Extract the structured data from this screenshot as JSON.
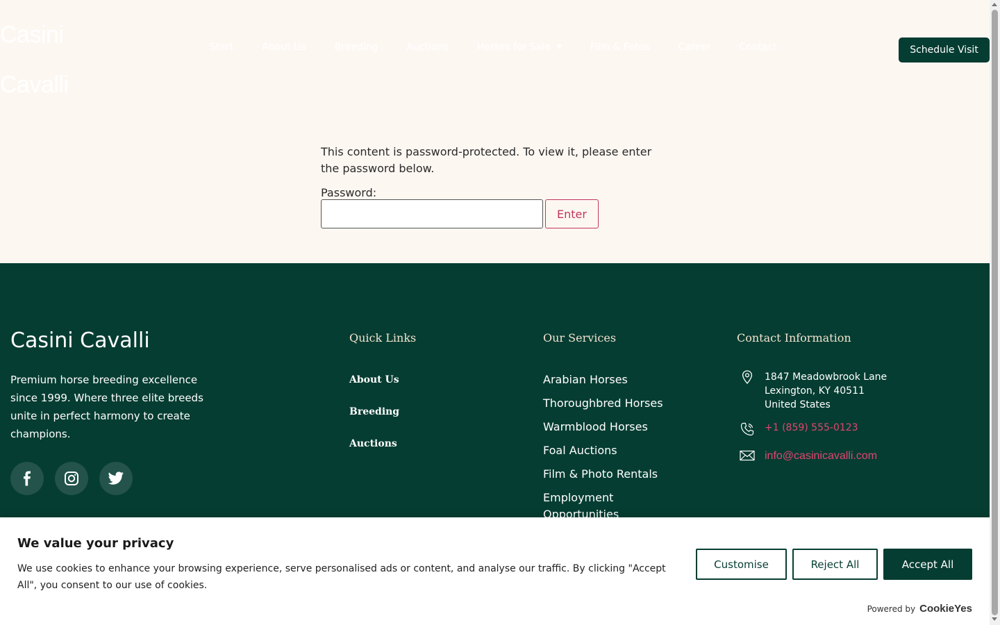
{
  "header": {
    "logo_line1": "Casini",
    "logo_line2": "Cavalli",
    "nav": [
      {
        "label": "Start"
      },
      {
        "label": "About Us"
      },
      {
        "label": "Breeding"
      },
      {
        "label": "Auctions"
      },
      {
        "label": "Horses for Sale"
      },
      {
        "label": "Film & Fotos"
      },
      {
        "label": "Career"
      },
      {
        "label": "Contact"
      }
    ],
    "schedule_label": "Schedule Visit"
  },
  "password": {
    "message": "This content is password-protected. To view it, please enter the password below.",
    "label": "Password:",
    "value": "",
    "enter_label": "Enter"
  },
  "footer": {
    "brand_name": "Casini Cavalli",
    "brand_desc": "Premium horse breeding excellence since 1999. Where three elite breeds unite in perfect harmony to create champions.",
    "socials": [
      {
        "icon": "facebook-icon"
      },
      {
        "icon": "instagram-icon"
      },
      {
        "icon": "twitter-icon"
      }
    ],
    "quick_links_title": "Quick Links",
    "quick_links": [
      {
        "label": "About Us"
      },
      {
        "label": "Breeding"
      },
      {
        "label": "Auctions"
      }
    ],
    "services_title": "Our Services",
    "services": [
      {
        "label": "Arabian Horses"
      },
      {
        "label": "Thoroughbred Horses"
      },
      {
        "label": "Warmblood Horses"
      },
      {
        "label": "Foal Auctions"
      },
      {
        "label": "Film & Photo Rentals"
      },
      {
        "label": "Employment Opportunities"
      }
    ],
    "contact_title": "Contact Information",
    "address_line1": "1847 Meadowbrook Lane",
    "address_line2": "Lexington, KY 40511",
    "address_line3": "United States",
    "phone": "+1 (859) 555-0123",
    "email": "info@casinicavalli.com"
  },
  "cookie": {
    "title": "We value your privacy",
    "text": "We use cookies to enhance your browsing experience, serve personalised ads or content, and analyse our traffic. By clicking \"Accept All\", you consent to our use of cookies.",
    "customise_label": "Customise",
    "reject_label": "Reject All",
    "accept_label": "Accept All",
    "powered_label": "Powered by",
    "powered_brand": "CookieYes"
  },
  "colors": {
    "primary": "#063d32",
    "accent": "#e0466f",
    "background": "#fdf7f2",
    "heading_light": "#f3e3cf"
  }
}
